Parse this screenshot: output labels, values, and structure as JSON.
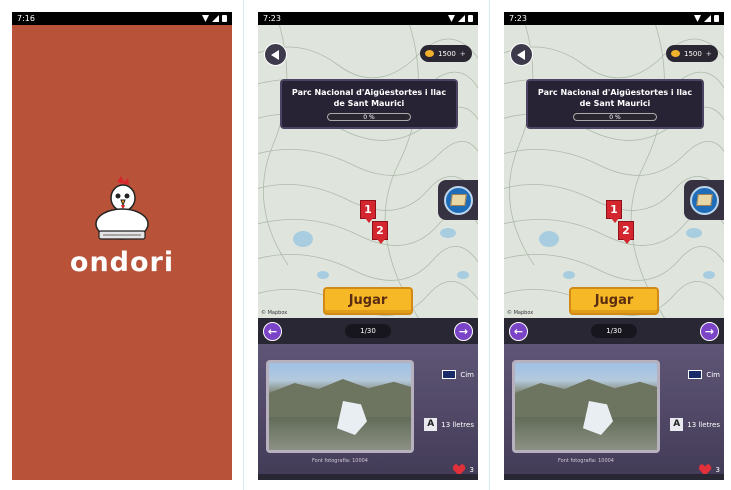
{
  "screens": [
    {
      "status_time": "7:16",
      "brand": "ondori",
      "background_color": "#b85339"
    },
    {
      "status_time": "7:23",
      "coins": "1500",
      "coins_plus": "+",
      "park_title": "Parc Nacional d'Aigüestortes i llac de Sant Maurici",
      "progress_text": "0 %",
      "progress": 0,
      "markers": [
        "1",
        "2"
      ],
      "play_label": "Jugar",
      "mapbox_credit": "© Mapbox",
      "counter": "1/30",
      "stats": {
        "type": "Cim",
        "letters": "13 lletres",
        "lives": "3"
      },
      "photo_credit": "Font fotografia: 10004"
    },
    {
      "status_time": "7:23",
      "coins": "1500",
      "coins_plus": "+",
      "park_title": "Parc Nacional d'Aigüestortes i llac de Sant Maurici",
      "progress_text": "0 %",
      "progress": 0,
      "markers": [
        "1",
        "2"
      ],
      "play_label": "Jugar",
      "mapbox_credit": "© Mapbox",
      "counter": "1/30",
      "stats": {
        "type": "Cim",
        "letters": "13 lletres",
        "lives": "3"
      },
      "photo_credit": "Font fotografia: 10004"
    }
  ],
  "icons": {
    "letter_glyph": "A",
    "arrow_left": "←",
    "arrow_right": "→"
  }
}
